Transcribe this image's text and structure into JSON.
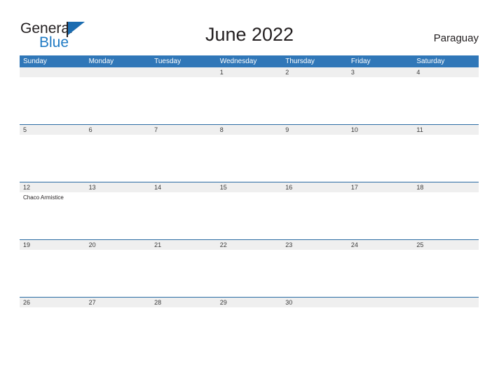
{
  "logo": {
    "word_one": "General",
    "word_two": "Blue",
    "flag_icon": "blue-flag-triangle-icon"
  },
  "header": {
    "title": "June 2022",
    "country": "Paraguay"
  },
  "calendar": {
    "day_headers": [
      "Sunday",
      "Monday",
      "Tuesday",
      "Wednesday",
      "Thursday",
      "Friday",
      "Saturday"
    ],
    "weeks": [
      {
        "days": [
          {
            "date": "",
            "events": []
          },
          {
            "date": "",
            "events": []
          },
          {
            "date": "",
            "events": []
          },
          {
            "date": "1",
            "events": []
          },
          {
            "date": "2",
            "events": []
          },
          {
            "date": "3",
            "events": []
          },
          {
            "date": "4",
            "events": []
          }
        ]
      },
      {
        "days": [
          {
            "date": "5",
            "events": []
          },
          {
            "date": "6",
            "events": []
          },
          {
            "date": "7",
            "events": []
          },
          {
            "date": "8",
            "events": []
          },
          {
            "date": "9",
            "events": []
          },
          {
            "date": "10",
            "events": []
          },
          {
            "date": "11",
            "events": []
          }
        ]
      },
      {
        "days": [
          {
            "date": "12",
            "events": [
              "Chaco Armistice"
            ]
          },
          {
            "date": "13",
            "events": []
          },
          {
            "date": "14",
            "events": []
          },
          {
            "date": "15",
            "events": []
          },
          {
            "date": "16",
            "events": []
          },
          {
            "date": "17",
            "events": []
          },
          {
            "date": "18",
            "events": []
          }
        ]
      },
      {
        "days": [
          {
            "date": "19",
            "events": []
          },
          {
            "date": "20",
            "events": []
          },
          {
            "date": "21",
            "events": []
          },
          {
            "date": "22",
            "events": []
          },
          {
            "date": "23",
            "events": []
          },
          {
            "date": "24",
            "events": []
          },
          {
            "date": "25",
            "events": []
          }
        ]
      },
      {
        "days": [
          {
            "date": "26",
            "events": []
          },
          {
            "date": "27",
            "events": []
          },
          {
            "date": "28",
            "events": []
          },
          {
            "date": "29",
            "events": []
          },
          {
            "date": "30",
            "events": []
          },
          {
            "date": "",
            "events": []
          },
          {
            "date": "",
            "events": []
          }
        ]
      }
    ]
  },
  "colors": {
    "header_blue": "#3077b8",
    "logo_blue": "#1f7ac4",
    "row_separator": "#2b6ca3",
    "date_band": "#efefef",
    "text_dark": "#231f20"
  }
}
